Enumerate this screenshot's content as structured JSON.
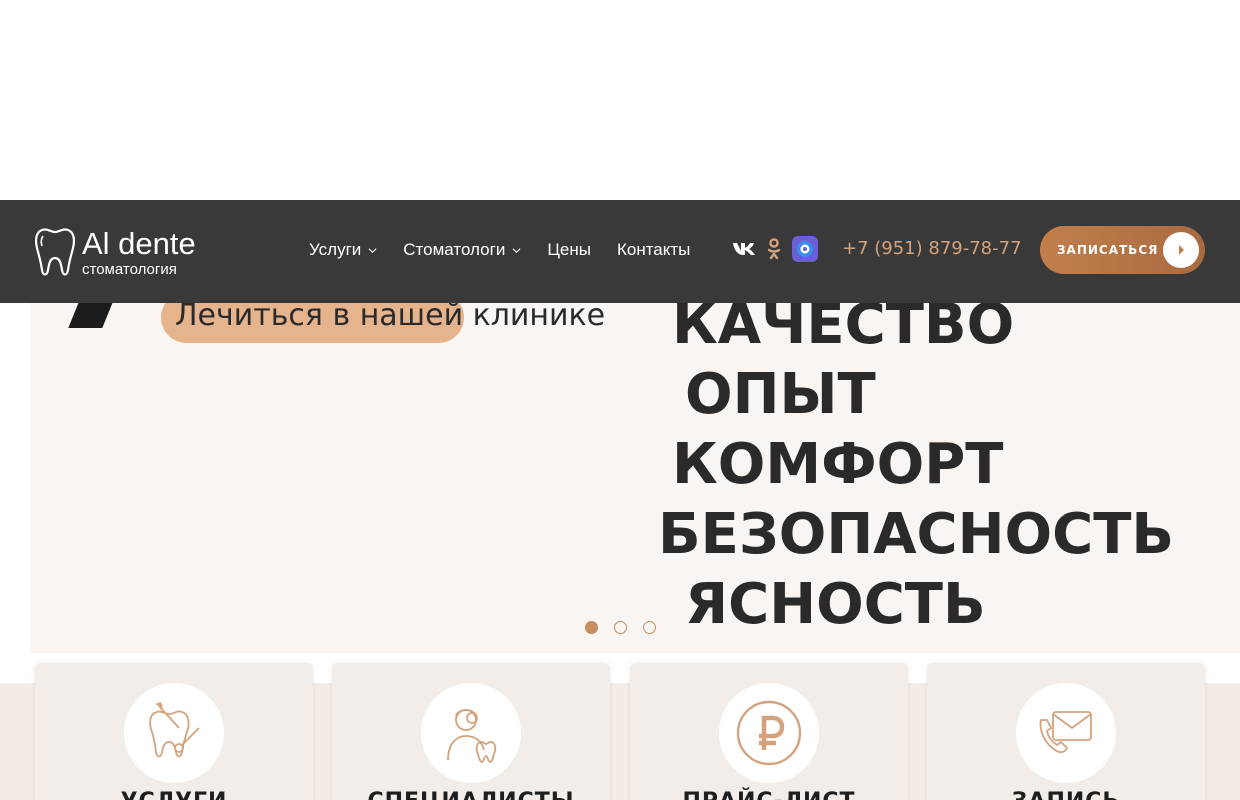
{
  "header": {
    "logo_name": "Al dente",
    "logo_sub": "стоматология",
    "nav": [
      {
        "label": "Услуги",
        "has_dropdown": true
      },
      {
        "label": "Стоматологи",
        "has_dropdown": true
      },
      {
        "label": "Цены",
        "has_dropdown": false
      },
      {
        "label": "Контакты",
        "has_dropdown": false
      }
    ],
    "socials": [
      "vk-icon",
      "odnoklassniki-icon",
      "rutube-icon"
    ],
    "phone": "+7 (951) 879-78-77",
    "cta_label": "ЗАПИСАТЬСЯ"
  },
  "hero": {
    "tagline": "Лечиться в нашей клинике",
    "words": [
      "КАЧЕСТВО",
      "ОПЫТ",
      "КОМФОРТ",
      "БЕЗОПАСНОСТЬ",
      "ЯСНОСТЬ"
    ],
    "slide_count": 3,
    "active_slide": 1
  },
  "features": [
    {
      "title": "УСЛУГИ",
      "icon": "tooth-dental-tools-icon"
    },
    {
      "title": "СПЕЦИАЛИСТЫ",
      "icon": "dentist-icon"
    },
    {
      "title": "ПРАЙС-ЛИСТ",
      "icon": "ruble-icon"
    },
    {
      "title": "ЗАПИСЬ",
      "icon": "phone-mail-icon"
    }
  ],
  "colors": {
    "header_bg": "#393939",
    "accent": "#c88c5e",
    "phone": "#d4a27c",
    "hero_bg": "#f8f5f2",
    "pill": "#e6b48c"
  }
}
